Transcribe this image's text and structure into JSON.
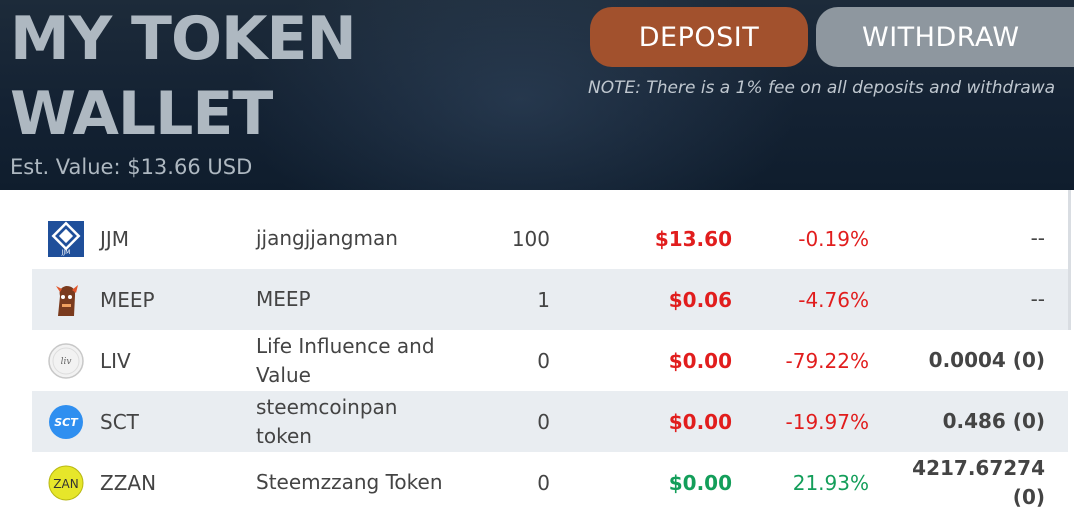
{
  "header": {
    "title_line1": "MY TOKEN",
    "title_line2": "WALLET",
    "est_value": "Est. Value: $13.66 USD",
    "deposit_label": "DEPOSIT",
    "withdraw_label": "WITHDRAW",
    "note": "NOTE: There is a 1% fee on all deposits and withdrawa"
  },
  "colors": {
    "header_bg": "#142233",
    "deposit": "#a2512d",
    "withdraw": "#8e979f",
    "negative": "#e11d1d",
    "positive": "#139e5a"
  },
  "tokens": [
    {
      "icon": "jjm-logo-icon",
      "symbol": "JJM",
      "name": "jjangjjangman",
      "balance": "100",
      "price": "$13.60",
      "change": "-0.19%",
      "extra": "--"
    },
    {
      "icon": "meep-logo-icon",
      "symbol": "MEEP",
      "name": "MEEP",
      "balance": "1",
      "price": "$0.06",
      "change": "-4.76%",
      "extra": "--"
    },
    {
      "icon": "liv-logo-icon",
      "symbol": "LIV",
      "name": "Life Influence and Value",
      "balance": "0",
      "price": "$0.00",
      "change": "-79.22%",
      "extra": "0.0004 (0)"
    },
    {
      "icon": "sct-logo-icon",
      "symbol": "SCT",
      "name": "steemcoinpan token",
      "balance": "0",
      "price": "$0.00",
      "change": "-19.97%",
      "extra": "0.486 (0)"
    },
    {
      "icon": "zzan-logo-icon",
      "symbol": "ZZAN",
      "name": "Steemzzang Token",
      "balance": "0",
      "price": "$0.00",
      "change": "21.93%",
      "extra": "4217.67274 (0)"
    }
  ],
  "icon_text": {
    "jjm": "JJM",
    "liv": "liv",
    "sct": "SCT",
    "zzan": "ZAN"
  }
}
